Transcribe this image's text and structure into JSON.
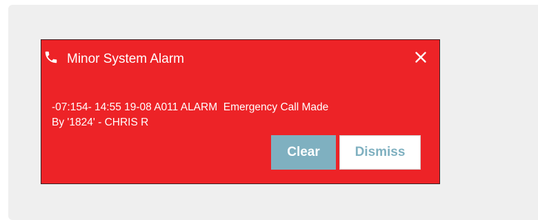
{
  "alarm": {
    "title": "Minor System Alarm",
    "message": "-07:154- 14:55 19-08 A011 ALARM  Emergency Call Made\nBy '1824' - CHRIS R",
    "clear_label": "Clear",
    "dismiss_label": "Dismiss",
    "icons": {
      "leading": "phone-icon",
      "close": "close-icon"
    },
    "colors": {
      "background": "#ed2327",
      "text": "#ffffff",
      "clear_button_bg": "#7fb0c0",
      "dismiss_button_bg": "#ffffff",
      "dismiss_button_text": "#7fb0c0",
      "page_panel": "#efefef"
    }
  }
}
